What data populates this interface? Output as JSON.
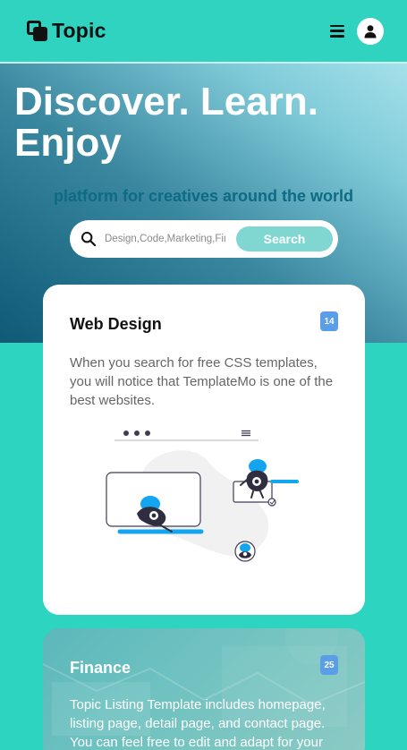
{
  "nav": {
    "brand": "Topic",
    "icons": [
      "brand-logo",
      "menu-icon",
      "user-icon"
    ]
  },
  "hero": {
    "title": "Discover. Learn. Enjoy",
    "subtitle": "platform for creatives around the world"
  },
  "search": {
    "placeholder": "Design,Code,Marketing,Finance ...",
    "button_label": "Search"
  },
  "cards": [
    {
      "title": "Web Design",
      "badge": "14",
      "text": "When you search for free CSS templates, you will notice that TemplateMo is one of the best websites."
    },
    {
      "title": "Finance",
      "badge": "25",
      "text": "Topic Listing Template includes homepage, listing page, detail page, and contact page. You can feel free to edit and adapt for your needs."
    }
  ],
  "colors": {
    "page_bg": "#2dd4bf",
    "badge": "#5a9ee8",
    "accent_blue": "#13a5f0",
    "search_button": "#80d6d0"
  }
}
